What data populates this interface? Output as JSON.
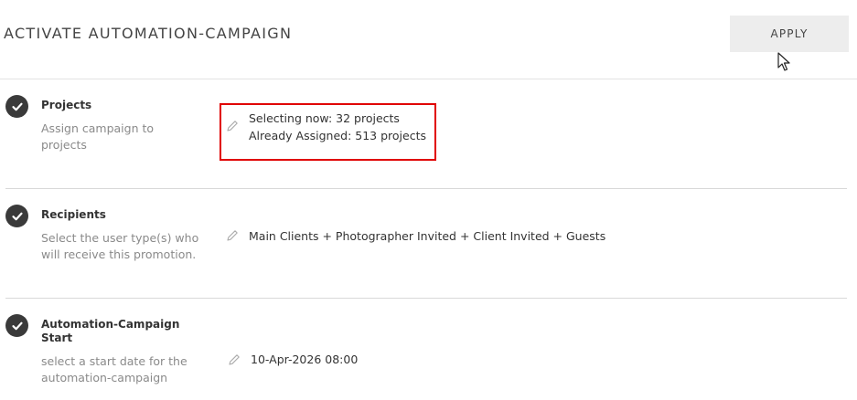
{
  "header": {
    "title": "ACTIVATE AUTOMATION-CAMPAIGN",
    "apply_label": "APPLY"
  },
  "sections": {
    "projects": {
      "title": "Projects",
      "description": "Assign campaign to projects",
      "value_line1": "Selecting now: 32 projects",
      "value_line2": "Already Assigned: 513 projects"
    },
    "recipients": {
      "title": "Recipients",
      "description": "Select the user type(s) who will receive this promotion.",
      "value": "Main Clients + Photographer Invited + Client Invited + Guests"
    },
    "start": {
      "title": "Automation-Campaign Start",
      "description": "select a start date for the automation-campaign",
      "value": "10-Apr-2026 08:00"
    }
  },
  "icons": {
    "check": "check-circle-icon",
    "edit": "pencil-icon",
    "cursor": "mouse-pointer-icon"
  },
  "colors": {
    "check_bg": "#3a3a3a",
    "highlight": "#e00000",
    "apply_bg": "#ededed"
  }
}
